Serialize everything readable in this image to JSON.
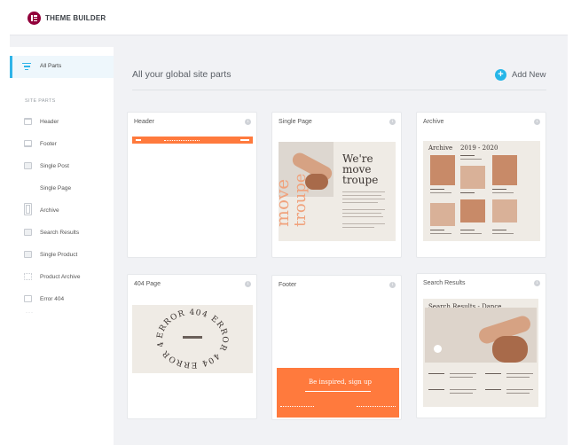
{
  "app": {
    "title": "THEME BUILDER"
  },
  "sidebar": {
    "all_parts": "All Parts",
    "section_label": "SITE PARTS",
    "items": [
      {
        "label": "Header",
        "icon": "header-template-icon"
      },
      {
        "label": "Footer",
        "icon": "footer-template-icon"
      },
      {
        "label": "Single Post",
        "icon": "single-post-icon"
      },
      {
        "label": "Single Page",
        "icon": "single-page-icon"
      },
      {
        "label": "Archive",
        "icon": "archive-icon"
      },
      {
        "label": "Search Results",
        "icon": "search-results-icon"
      },
      {
        "label": "Single Product",
        "icon": "single-product-icon"
      },
      {
        "label": "Product Archive",
        "icon": "product-archive-icon"
      },
      {
        "label": "Error 404",
        "icon": "error-404-icon"
      }
    ]
  },
  "main": {
    "title": "All your global site parts",
    "add_new": "Add New"
  },
  "cards": {
    "header": {
      "title": "Header"
    },
    "single_page": {
      "title": "Single Page",
      "headline_1": "We're",
      "headline_2": "move",
      "headline_3": "troupe",
      "vertical": "move"
    },
    "archive": {
      "title": "Archive",
      "heading": "Archive",
      "years": "2019 - 2020"
    },
    "page_404": {
      "title": "404 Page",
      "ring": "ERROR 404 ERROR 404 ERROR 404"
    },
    "footer": {
      "title": "Footer",
      "cta": "Be inspired, sign up"
    },
    "search": {
      "title": "Search Results",
      "heading": "Search Results - Dance"
    }
  },
  "colors": {
    "accent": "#26b6e8",
    "brand": "#92003b",
    "orange": "#ff7a3d",
    "beige": "#efebe5"
  }
}
